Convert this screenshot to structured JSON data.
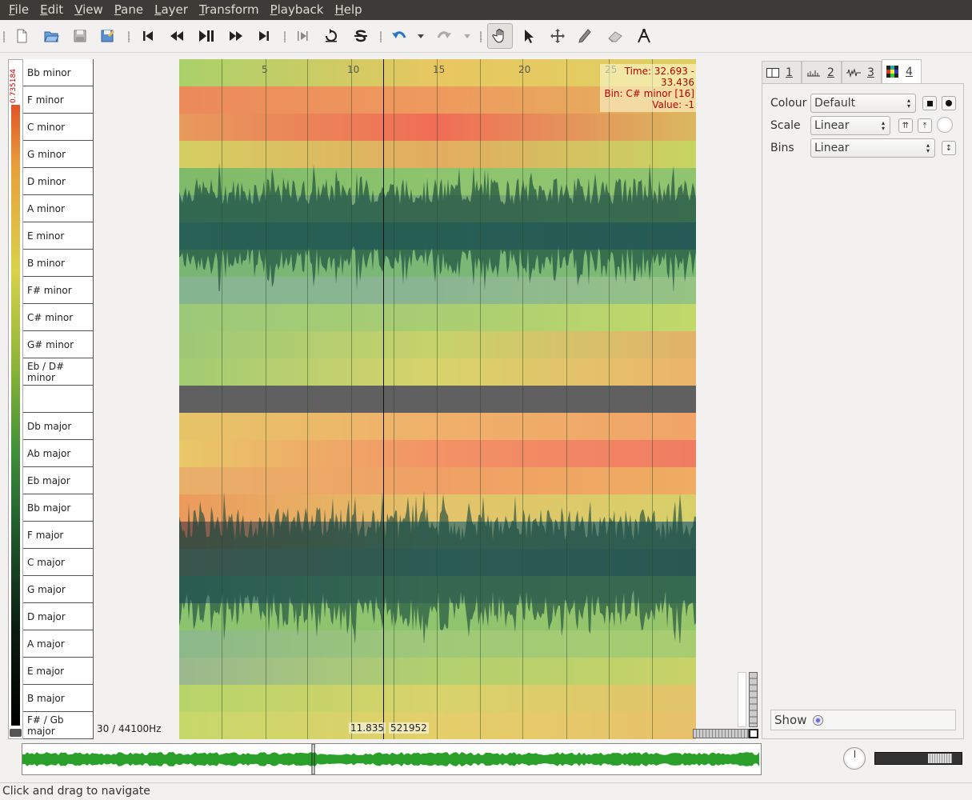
{
  "menubar": [
    "File",
    "Edit",
    "View",
    "Pane",
    "Layer",
    "Transform",
    "Playback",
    "Help"
  ],
  "toolbar": {
    "buttons": [
      "new-icon",
      "open-icon",
      "save-icon",
      "save-as-icon",
      "rewind-start-icon",
      "rewind-icon",
      "play-pause-icon",
      "fast-forward-icon",
      "fast-forward-end-icon",
      "play-selection-icon",
      "loop-icon",
      "solo-icon",
      "undo-icon",
      "redo-icon",
      "navigate-icon",
      "select-icon",
      "move-icon",
      "draw-icon",
      "erase-icon",
      "measure-icon"
    ],
    "active": "navigate-icon"
  },
  "scale": {
    "max_label": "0.735184"
  },
  "keys": [
    "Bb minor",
    "F minor",
    "C minor",
    "G minor",
    "D minor",
    "A minor",
    "E minor",
    "B minor",
    "F# minor",
    "C# minor",
    "G# minor",
    "Eb / D# minor",
    "",
    "Db major",
    "Ab major",
    "Eb major",
    "Bb major",
    "F major",
    "C major",
    "G major",
    "D major",
    "A major",
    "E major",
    "B major",
    "F# / Gb major"
  ],
  "rate_label": "30 / 44100Hz",
  "timeline": {
    "ticks": [
      "5",
      "10",
      "15",
      "20",
      "25"
    ]
  },
  "info": {
    "time": "Time: 32.693 - 33.436",
    "bin": "Bin: C# minor [16]",
    "value": "Value: -1"
  },
  "readout": {
    "seconds": "11.835",
    "frame": "521952"
  },
  "tabs": [
    {
      "icon": "pane-icon",
      "label": "1"
    },
    {
      "icon": "ruler-icon",
      "label": "2"
    },
    {
      "icon": "waveform-icon",
      "label": "3"
    },
    {
      "icon": "colour-grid-icon",
      "label": "4"
    }
  ],
  "selected_tab": "4",
  "props": {
    "colour_label": "Colour",
    "colour_value": "Default",
    "scale_label": "Scale",
    "scale_value": "Linear",
    "bins_label": "Bins",
    "bins_value": "Linear",
    "show_label": "Show"
  },
  "status": "Click and drag to navigate"
}
